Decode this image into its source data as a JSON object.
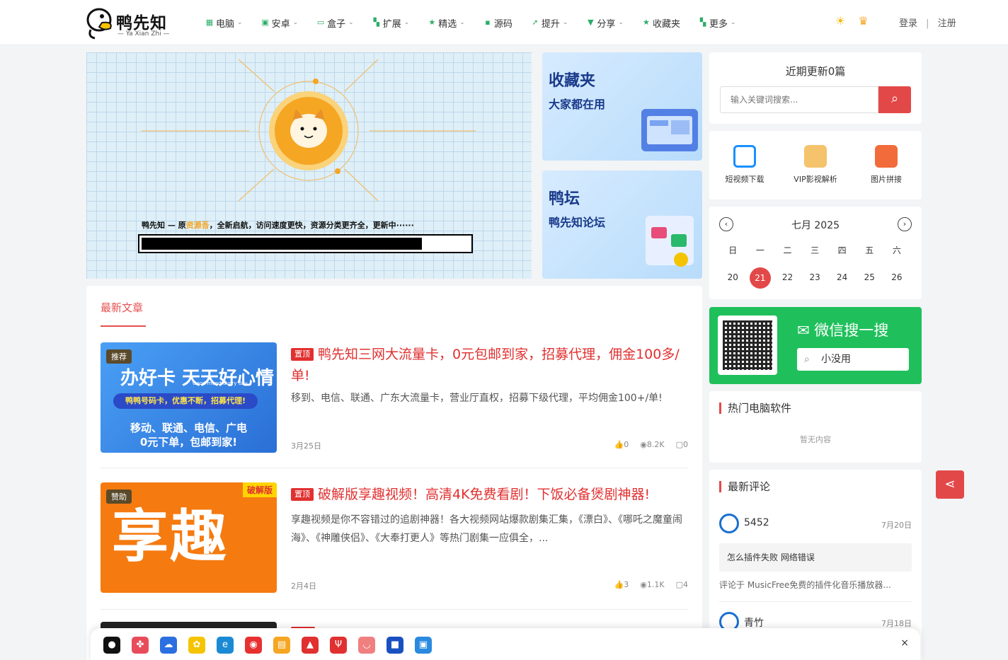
{
  "header": {
    "logo_text": "鸭先知",
    "logo_sub": "— Ya Xian Zhi —",
    "nav": [
      {
        "label": "电脑",
        "icon": "windows-icon",
        "dropdown": true
      },
      {
        "label": "安卓",
        "icon": "android-icon",
        "dropdown": true
      },
      {
        "label": "盒子",
        "icon": "tv-icon",
        "dropdown": true
      },
      {
        "label": "扩展",
        "icon": "grid-icon",
        "dropdown": true
      },
      {
        "label": "精选",
        "icon": "star-icon",
        "dropdown": true
      },
      {
        "label": "源码",
        "icon": "code-icon",
        "dropdown": false
      },
      {
        "label": "提升",
        "icon": "rocket-icon",
        "dropdown": true
      },
      {
        "label": "分享",
        "icon": "send-icon",
        "dropdown": true
      },
      {
        "label": "收藏夹",
        "icon": "star-icon",
        "dropdown": false
      },
      {
        "label": "更多",
        "icon": "grid-icon",
        "dropdown": true
      }
    ],
    "login": "登录",
    "register": "注册",
    "separator": "|"
  },
  "banner": {
    "text_pre": "鸭先知 — 原",
    "text_hl": "资源吾",
    "text_post": "，全新启航，访问速度更快，资源分类更齐全，更新中······",
    "progress": 0.85
  },
  "promos": [
    {
      "title": "收藏夹",
      "subtitle": "大家都在用"
    },
    {
      "title": "鸭坛",
      "subtitle": "鸭先知论坛"
    }
  ],
  "main": {
    "tab": "最新文章",
    "articles": [
      {
        "badge": "推荐",
        "tag": "置顶",
        "title": "鸭先知三网大流量卡，0元包邮到家，招募代理，佣金100多/单!",
        "desc": "移到、电信、联通、广东大流量卡，营业厅直权，招募下级代理，平均佣金100+/单!",
        "date": "3月25日",
        "likes": "0",
        "views": "8.2K",
        "comments": "0",
        "thumb_lines": [
          "办好卡 天天好心情",
          "Good mood every day",
          "鸭鸭号码卡，优惠不断，招募代理!",
          "移动、联通、电信、广电",
          "0元下单，包邮到家!"
        ]
      },
      {
        "badge": "赞助",
        "tag": "置顶",
        "title": "破解版享趣视频！高清4K免费看剧！下饭必备煲剧神器!",
        "desc": "享趣视频是你不容错过的追剧神器！各大视频网站爆款剧集汇集，《漂白》、《哪吒之魔童闹海》、《神雕侠侣》、《大奉打更人》等热门剧集一应俱全，...",
        "date": "2月4日",
        "likes": "3",
        "views": "1.1K",
        "comments": "4",
        "thumb_lines": [
          "破解版",
          "享趣"
        ]
      }
    ]
  },
  "sidebar": {
    "search_title": "近期更新0篇",
    "search_placeholder": "输入关键词搜索...",
    "tools": [
      {
        "label": "短视频下载",
        "color": "#1a90ff"
      },
      {
        "label": "VIP影视解析",
        "color": "#f5c36b"
      },
      {
        "label": "图片拼接",
        "color": "#f26b3a"
      }
    ],
    "calendar": {
      "month": "七月 2025",
      "weekdays": [
        "日",
        "一",
        "二",
        "三",
        "四",
        "五",
        "六"
      ],
      "days": [
        "20",
        "21",
        "22",
        "23",
        "24",
        "25",
        "26"
      ],
      "today": "21"
    },
    "wechat": {
      "title": "微信搜一搜",
      "query": "小没用"
    },
    "hot_title": "热门电脑软件",
    "hot_empty": "暂无内容",
    "comments_title": "最新评论",
    "comments": [
      {
        "name": "5452",
        "date": "7月20日",
        "text": "怎么插件失败 网络错误",
        "ref": "评论于 MusicFree免费的插件化音乐播放器..."
      },
      {
        "name": "青竹",
        "date": "7月18日"
      }
    ]
  },
  "dock": {
    "icons": [
      {
        "name": "qq-icon",
        "color": "#111",
        "glyph": "●"
      },
      {
        "name": "pinwheel-icon",
        "color": "#e84c5a",
        "glyph": "✤"
      },
      {
        "name": "cloud-icon",
        "color": "#2c6fe0",
        "glyph": "☁"
      },
      {
        "name": "duck-icon",
        "color": "#f5c400",
        "glyph": "✿"
      },
      {
        "name": "edge-icon",
        "color": "#1a8ad4",
        "glyph": "e"
      },
      {
        "name": "donut-icon",
        "color": "#e83030",
        "glyph": "◉"
      },
      {
        "name": "burger-icon",
        "color": "#f5a623",
        "glyph": "▤"
      },
      {
        "name": "car-icon",
        "color": "#e03030",
        "glyph": "▲"
      },
      {
        "name": "fork-icon",
        "color": "#e03030",
        "glyph": "Ψ"
      },
      {
        "name": "cup-icon",
        "color": "#f08080",
        "glyph": "◡"
      },
      {
        "name": "truck-icon",
        "color": "#1a50c0",
        "glyph": "■"
      },
      {
        "name": "card-icon",
        "color": "#2a8ae0",
        "glyph": "▣"
      }
    ],
    "close": "×"
  }
}
